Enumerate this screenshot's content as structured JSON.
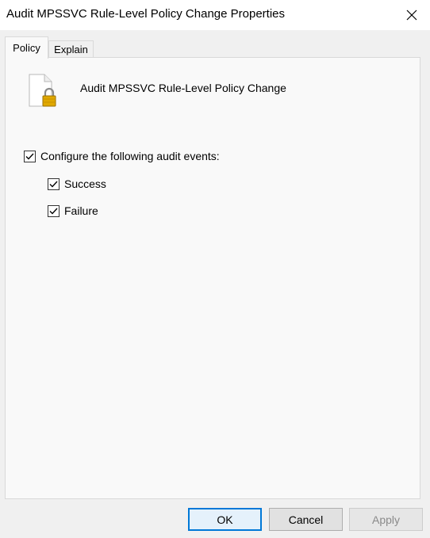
{
  "window": {
    "title": "Audit MPSSVC Rule-Level Policy Change Properties"
  },
  "tabs": [
    {
      "label": "Policy",
      "active": true
    },
    {
      "label": "Explain",
      "active": false
    }
  ],
  "policy": {
    "name": "Audit MPSSVC Rule-Level Policy Change",
    "icon": "locked-document-icon"
  },
  "options": {
    "configure": {
      "label": "Configure the following audit events:",
      "checked": true
    },
    "success": {
      "label": "Success",
      "checked": true
    },
    "failure": {
      "label": "Failure",
      "checked": true
    }
  },
  "buttons": {
    "ok": "OK",
    "cancel": "Cancel",
    "apply": "Apply"
  },
  "colors": {
    "accent": "#0078d7",
    "lock": "#e0a800"
  }
}
